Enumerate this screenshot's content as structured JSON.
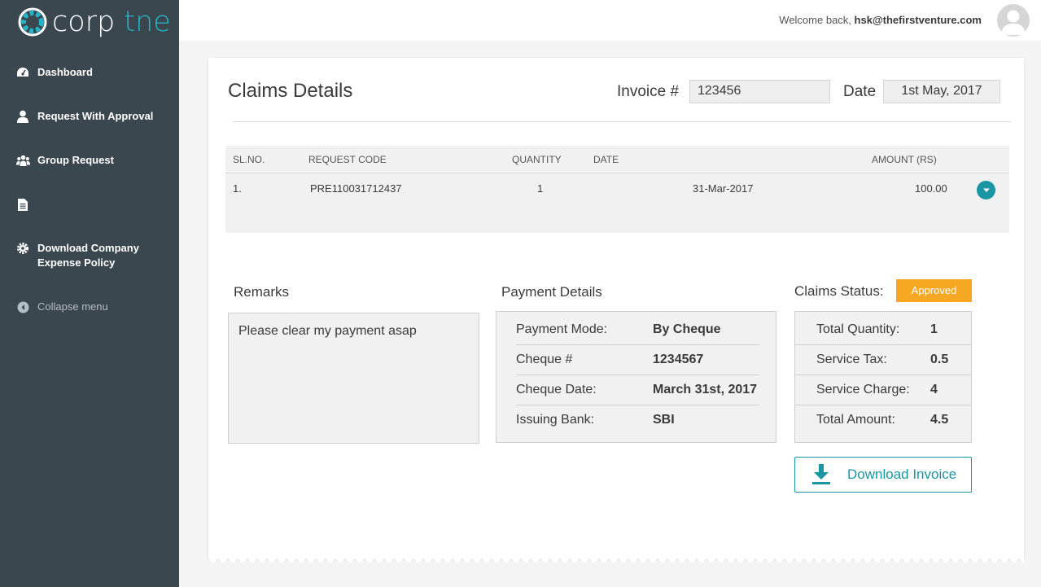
{
  "brand": {
    "name_part1": "corp",
    "name_part2": "tne",
    "accent": "#27b3c7"
  },
  "sidebar": {
    "items": [
      {
        "label": "Dashboard",
        "icon": "dashboard-icon"
      },
      {
        "label": "Request With Approval",
        "icon": "user-icon"
      },
      {
        "label": "Group Request",
        "icon": "group-icon"
      },
      {
        "label": "",
        "icon": "document-icon"
      },
      {
        "label": "Download Company Expense Policy",
        "icon": "gear-icon"
      },
      {
        "label": "Collapse menu",
        "icon": "collapse-icon"
      }
    ]
  },
  "header": {
    "welcome_text": "Welcome back,",
    "user_email": "hsk@thefirstventure.com"
  },
  "claims": {
    "title": "Claims Details",
    "invoice_label": "Invoice #",
    "invoice_value": "123456",
    "date_label": "Date",
    "date_value": "1st May, 2017"
  },
  "table": {
    "columns": [
      "SL.NO.",
      "REQUEST CODE",
      "QUANTITY",
      "DATE",
      "AMOUNT (RS)"
    ],
    "rows": [
      {
        "sl": "1.",
        "code": "PRE110031712437",
        "quantity": "1",
        "date": "31-Mar-2017",
        "amount": "100.00"
      }
    ]
  },
  "remarks": {
    "title": "Remarks",
    "text": "Please clear my payment asap"
  },
  "payment": {
    "title": "Payment Details",
    "rows": [
      {
        "label": "Payment Mode:",
        "value": "By Cheque"
      },
      {
        "label": "Cheque #",
        "value": "1234567"
      },
      {
        "label": "Cheque Date:",
        "value": "March 31st, 2017"
      },
      {
        "label": "Issuing Bank:",
        "value": "SBI"
      }
    ]
  },
  "status": {
    "title": "Claims Status:",
    "badge": "Approved",
    "badge_color": "#f7a823",
    "rows": [
      {
        "label": "Total Quantity:",
        "value": "1"
      },
      {
        "label": "Service Tax:",
        "value": "0.5"
      },
      {
        "label": "Service Charge:",
        "value": "4"
      },
      {
        "label": "Total Amount:",
        "value": "4.5"
      }
    ]
  },
  "download_button": {
    "label": "Download Invoice",
    "icon": "download-icon",
    "color": "#1a95a3"
  }
}
